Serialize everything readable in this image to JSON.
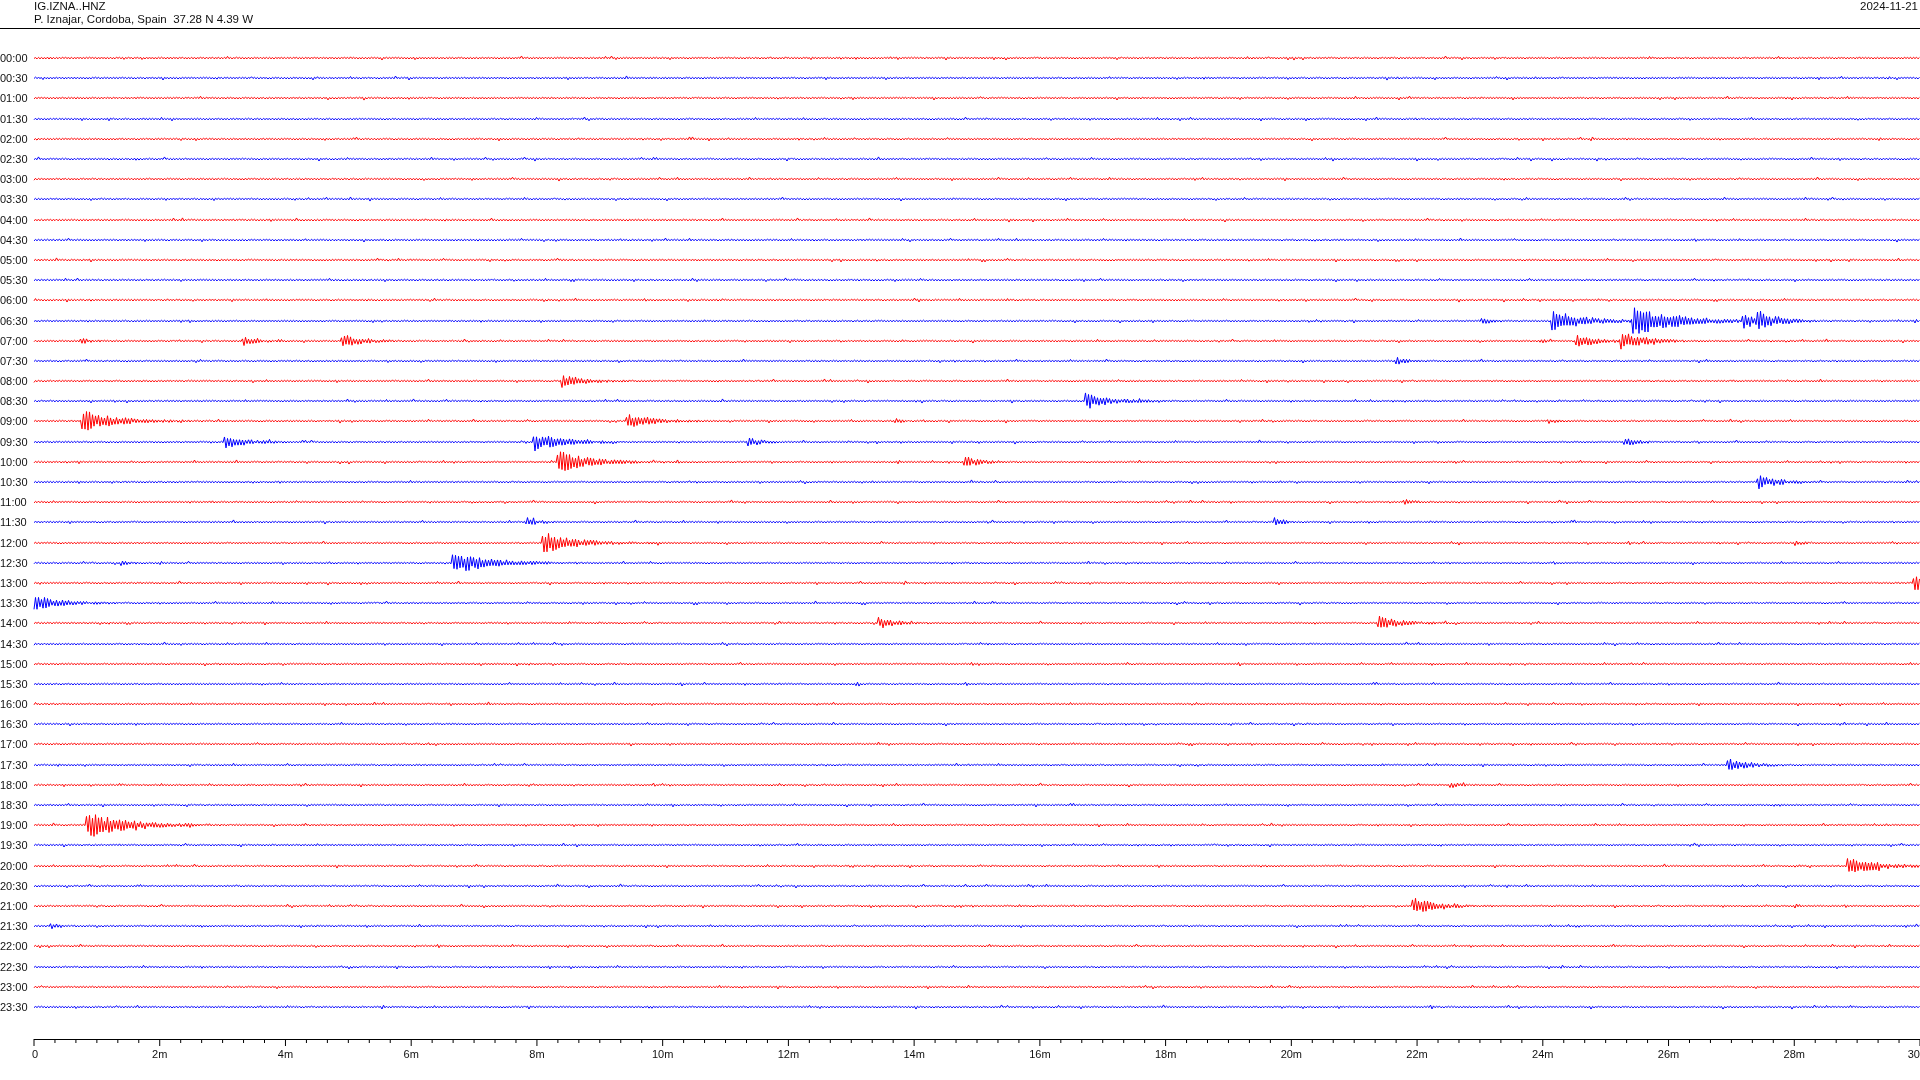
{
  "header": {
    "station": "IG.IZNA..HNZ",
    "location": "P. Iznajar, Cordoba, Spain  37.28 N 4.39 W",
    "date": "2024-11-21"
  },
  "rows": [
    {
      "time": "00:00",
      "color": "#ff0000"
    },
    {
      "time": "00:30",
      "color": "#0000ff"
    },
    {
      "time": "01:00",
      "color": "#ff0000"
    },
    {
      "time": "01:30",
      "color": "#0000ff"
    },
    {
      "time": "02:00",
      "color": "#ff0000"
    },
    {
      "time": "02:30",
      "color": "#0000ff"
    },
    {
      "time": "03:00",
      "color": "#ff0000"
    },
    {
      "time": "03:30",
      "color": "#0000ff"
    },
    {
      "time": "04:00",
      "color": "#ff0000"
    },
    {
      "time": "04:30",
      "color": "#0000ff"
    },
    {
      "time": "05:00",
      "color": "#ff0000"
    },
    {
      "time": "05:30",
      "color": "#0000ff"
    },
    {
      "time": "06:00",
      "color": "#ff0000"
    },
    {
      "time": "06:30",
      "color": "#0000ff"
    },
    {
      "time": "07:00",
      "color": "#ff0000"
    },
    {
      "time": "07:30",
      "color": "#0000ff"
    },
    {
      "time": "08:00",
      "color": "#ff0000"
    },
    {
      "time": "08:30",
      "color": "#0000ff"
    },
    {
      "time": "09:00",
      "color": "#ff0000"
    },
    {
      "time": "09:30",
      "color": "#0000ff"
    },
    {
      "time": "10:00",
      "color": "#ff0000"
    },
    {
      "time": "10:30",
      "color": "#0000ff"
    },
    {
      "time": "11:00",
      "color": "#ff0000"
    },
    {
      "time": "11:30",
      "color": "#0000ff"
    },
    {
      "time": "12:00",
      "color": "#ff0000"
    },
    {
      "time": "12:30",
      "color": "#0000ff"
    },
    {
      "time": "13:00",
      "color": "#ff0000"
    },
    {
      "time": "13:30",
      "color": "#0000ff"
    },
    {
      "time": "14:00",
      "color": "#ff0000"
    },
    {
      "time": "14:30",
      "color": "#0000ff"
    },
    {
      "time": "15:00",
      "color": "#ff0000"
    },
    {
      "time": "15:30",
      "color": "#0000ff"
    },
    {
      "time": "16:00",
      "color": "#ff0000"
    },
    {
      "time": "16:30",
      "color": "#0000ff"
    },
    {
      "time": "17:00",
      "color": "#ff0000"
    },
    {
      "time": "17:30",
      "color": "#0000ff"
    },
    {
      "time": "18:00",
      "color": "#ff0000"
    },
    {
      "time": "18:30",
      "color": "#0000ff"
    },
    {
      "time": "19:00",
      "color": "#ff0000"
    },
    {
      "time": "19:30",
      "color": "#0000ff"
    },
    {
      "time": "20:00",
      "color": "#ff0000"
    },
    {
      "time": "20:30",
      "color": "#0000ff"
    },
    {
      "time": "21:00",
      "color": "#ff0000"
    },
    {
      "time": "21:30",
      "color": "#0000ff"
    },
    {
      "time": "22:00",
      "color": "#ff0000"
    },
    {
      "time": "22:30",
      "color": "#0000ff"
    },
    {
      "time": "23:00",
      "color": "#ff0000"
    },
    {
      "time": "23:30",
      "color": "#0000ff"
    }
  ],
  "x_axis": {
    "ticks": [
      "0",
      "2m",
      "4m",
      "6m",
      "8m",
      "10m",
      "12m",
      "14m",
      "16m",
      "18m",
      "20m",
      "22m",
      "24m",
      "26m",
      "28m",
      "30"
    ]
  }
}
